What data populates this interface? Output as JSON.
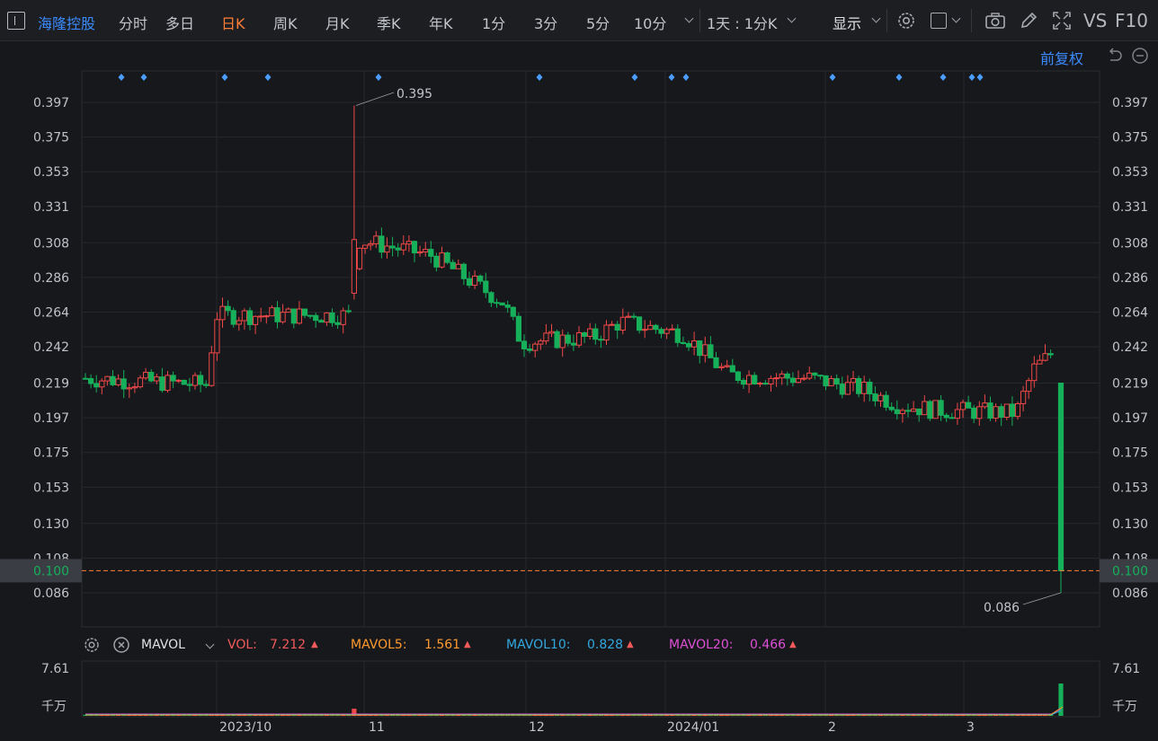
{
  "toolbar": {
    "stock_name": "海隆控股",
    "tabs": [
      {
        "label": "分时",
        "active": false
      },
      {
        "label": "多日",
        "active": false
      },
      {
        "label": "日K",
        "active": true
      },
      {
        "label": "周K",
        "active": false
      },
      {
        "label": "月K",
        "active": false
      },
      {
        "label": "季K",
        "active": false
      },
      {
        "label": "年K",
        "active": false
      },
      {
        "label": "1分",
        "active": false
      },
      {
        "label": "3分",
        "active": false
      },
      {
        "label": "5分",
        "active": false
      },
      {
        "label": "10分",
        "active": false
      }
    ],
    "period_select": "1天 : 1分K",
    "display_label": "显示",
    "vs_label": "VS",
    "f10_label": "F10",
    "icons": [
      "gear-icon",
      "square-icon",
      "camera-icon",
      "pen-icon",
      "fullscreen-icon"
    ]
  },
  "adjust_label": "前复权",
  "price_axis": {
    "ticks": [
      "0.397",
      "0.375",
      "0.353",
      "0.331",
      "0.308",
      "0.286",
      "0.264",
      "0.242",
      "0.219",
      "0.197",
      "0.175",
      "0.153",
      "0.130",
      "0.108",
      "0.086"
    ],
    "current_price": "0.100",
    "high_label": "0.395",
    "low_label": "0.086"
  },
  "volume_panel": {
    "indicator": "MAVOL",
    "vol_label": "VOL:",
    "vol_value": "7.212",
    "mavol5_label": "MAVOL5:",
    "mavol5_value": "1.561",
    "mavol10_label": "MAVOL10:",
    "mavol10_value": "0.828",
    "mavol20_label": "MAVOL20:",
    "mavol20_value": "0.466",
    "axis_top": "7.61",
    "axis_unit": "千万"
  },
  "x_axis": [
    "2023/10",
    "11",
    "12",
    "2024/01",
    "2",
    "3"
  ],
  "colors": {
    "up": "#f04848",
    "down": "#16b05a",
    "accent": "#ff7d36",
    "link": "#3b8bff",
    "marker": "#4a9dff",
    "vol": "#f05a5a",
    "mavol5": "#ff9a2e",
    "mavol10": "#32a8e0",
    "mavol20": "#e04fd8"
  }
}
